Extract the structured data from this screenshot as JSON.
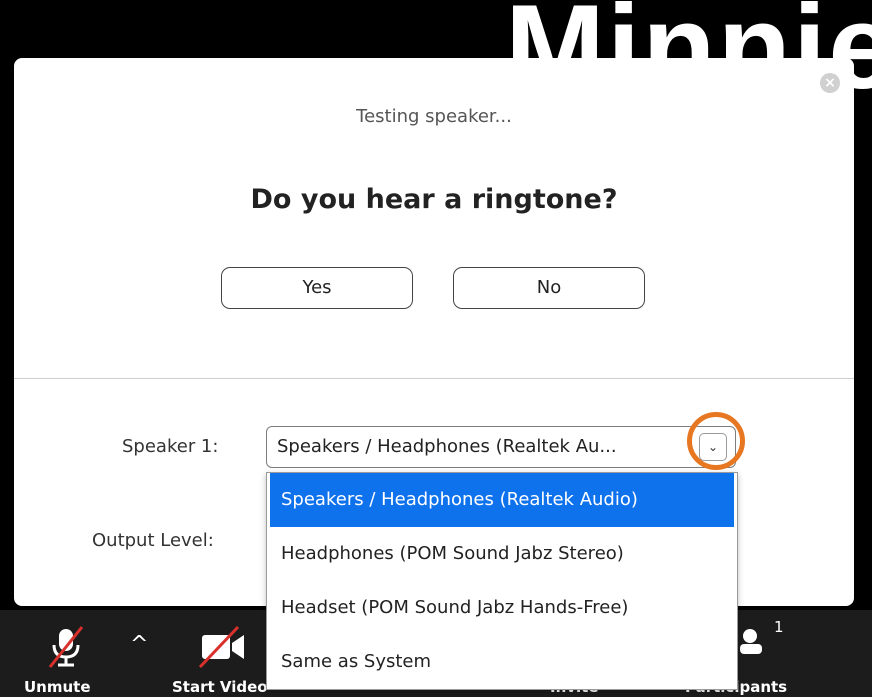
{
  "background": {
    "participant_name": "Minnie"
  },
  "dialog": {
    "status_text": "Testing speaker...",
    "question": "Do you hear a ringtone?",
    "yes_label": "Yes",
    "no_label": "No",
    "close_glyph": "×",
    "speaker_label": "Speaker 1:",
    "speaker_value": "Speakers / Headphones (Realtek Au...",
    "output_level_label": "Output Level:",
    "chevron_glyph": "⌄"
  },
  "dropdown": {
    "options": [
      "Speakers / Headphones (Realtek Audio)",
      "Headphones (POM Sound Jabz Stereo)",
      "Headset (POM Sound Jabz Hands-Free)",
      "Same as System"
    ],
    "selected_index": 0
  },
  "toolbar": {
    "unmute": "Unmute",
    "start_video": "Start Video",
    "invite": "Invite",
    "participants": "Participants",
    "participants_count": "1",
    "caret_glyph": "^"
  },
  "colors": {
    "accent": "#0e72ed",
    "highlight_ring": "#e87722",
    "mute_slash": "#d9302c"
  }
}
